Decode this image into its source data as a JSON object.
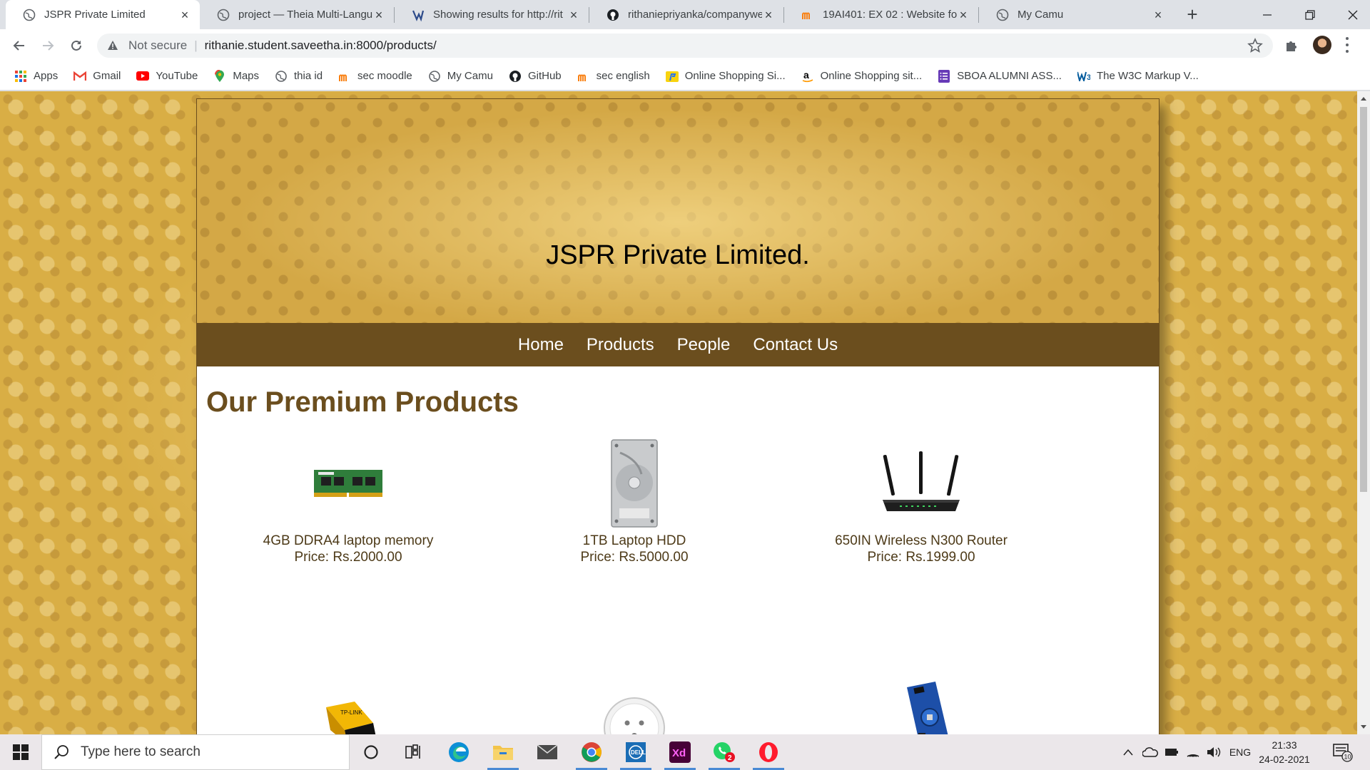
{
  "browser": {
    "tabs": [
      {
        "title": "JSPR Private Limited",
        "active": true,
        "icon": "globe-icon"
      },
      {
        "title": "project — Theia Multi-Langu",
        "active": false,
        "icon": "globe-icon"
      },
      {
        "title": "Showing results for http://rit",
        "active": false,
        "icon": "validator-icon"
      },
      {
        "title": "rithaniepriyanka/companywe",
        "active": false,
        "icon": "github-icon"
      },
      {
        "title": "19AI401: EX 02 : Website for",
        "active": false,
        "icon": "moodle-icon"
      },
      {
        "title": "My Camu",
        "active": false,
        "icon": "globe-icon"
      }
    ],
    "address": {
      "security_label": "Not secure",
      "url": "rithanie.student.saveetha.in:8000/products/"
    },
    "bookmarks": [
      {
        "label": "Apps",
        "icon": "apps-grid-icon"
      },
      {
        "label": "Gmail",
        "icon": "gmail-icon"
      },
      {
        "label": "YouTube",
        "icon": "youtube-icon"
      },
      {
        "label": "Maps",
        "icon": "maps-icon"
      },
      {
        "label": "thia id",
        "icon": "globe-icon"
      },
      {
        "label": "sec moodle",
        "icon": "moodle-icon"
      },
      {
        "label": "My Camu",
        "icon": "globe-icon"
      },
      {
        "label": "GitHub",
        "icon": "github-icon"
      },
      {
        "label": "sec english",
        "icon": "moodle-icon"
      },
      {
        "label": "Online Shopping Si...",
        "icon": "flipkart-icon"
      },
      {
        "label": "Online Shopping sit...",
        "icon": "amazon-icon"
      },
      {
        "label": "SBOA ALUMNI ASS...",
        "icon": "forms-icon"
      },
      {
        "label": "The W3C Markup V...",
        "icon": "w3c-icon"
      }
    ]
  },
  "site": {
    "title": "JSPR Private Limited.",
    "nav": [
      "Home",
      "Products",
      "People",
      "Contact Us"
    ],
    "heading": "Our Premium Products",
    "products": [
      {
        "name": "4GB DDRA4 laptop memory",
        "price": "Price: Rs.2000.00",
        "icon": "ram-stick-icon"
      },
      {
        "name": "1TB Laptop HDD",
        "price": "Price: Rs.5000.00",
        "icon": "hard-drive-icon"
      },
      {
        "name": "650IN Wireless N300 Router",
        "price": "Price: Rs.1999.00",
        "icon": "router-icon"
      },
      {
        "icon": "usb-wifi-adapter-icon"
      },
      {
        "icon": "smart-plug-icon"
      },
      {
        "icon": "sensor-module-icon"
      }
    ],
    "colors": {
      "brand_brown": "#6b4e1e",
      "gold_background": "#d9ae45"
    }
  },
  "taskbar": {
    "search_placeholder": "Type here to search",
    "apps": [
      "cortana-icon",
      "task-view-icon",
      "edge-icon",
      "file-explorer-icon",
      "mail-icon",
      "chrome-icon",
      "dell-icon",
      "adobe-xd-icon",
      "whatsapp-icon",
      "opera-icon"
    ],
    "whatsapp_badge": "2",
    "language": "ENG",
    "time": "21:33",
    "date": "24-02-2021",
    "notification_count": "10"
  }
}
